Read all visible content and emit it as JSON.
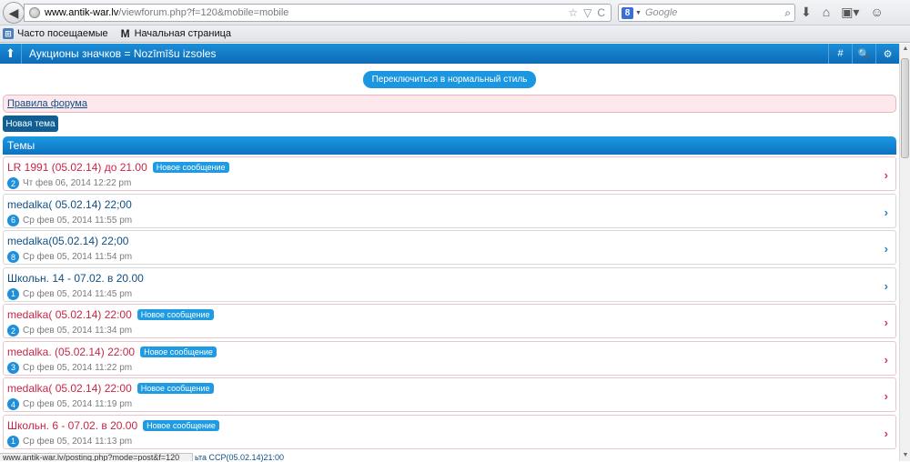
{
  "browser": {
    "url_host": "www.antik-war.lv",
    "url_path": "/viewforum.php?f=120&mobile=mobile",
    "search_engine_letter": "8",
    "search_placeholder": "Google",
    "bookmarks": [
      {
        "label": "Часто посещаемые",
        "icon": "frequent-icon"
      },
      {
        "label": "Начальная страница",
        "icon": "m-icon"
      }
    ],
    "status_url": "www.antik-war.lv/posting.php?mode=post&f=120"
  },
  "header": {
    "title": "Аукционы значков = Nozīmīšu izsoles",
    "buttons": [
      {
        "name": "hash-button",
        "glyph": "#"
      },
      {
        "name": "search-button",
        "glyph": "🔍"
      },
      {
        "name": "settings-button",
        "glyph": "⚙"
      }
    ]
  },
  "switch_style_label": "Переключиться в нормальный стиль",
  "rules_label": "Правила форума",
  "new_topic_label": "Новая тема",
  "topics_heading": "Темы",
  "badge_label": "Новое сообщение",
  "topics": [
    {
      "title": "LR 1991 (05.02.14) до 21.00",
      "count": "2",
      "date": "Чт фев 06, 2014 12:22 pm",
      "new": true
    },
    {
      "title": "medalka( 05.02.14) 22;00",
      "count": "6",
      "date": "Ср фев 05, 2014 11:55 pm",
      "new": false
    },
    {
      "title": "medalka(05.02.14) 22;00",
      "count": "8",
      "date": "Ср фев 05, 2014 11:54 pm",
      "new": false
    },
    {
      "title": "Школьн. 14 - 07.02. в 20.00",
      "count": "1",
      "date": "Ср фев 05, 2014 11:45 pm",
      "new": false
    },
    {
      "title": "medalka( 05.02.14) 22:00",
      "count": "2",
      "date": "Ср фев 05, 2014 11:34 pm",
      "new": true
    },
    {
      "title": "medalka. (05.02.14) 22:00",
      "count": "3",
      "date": "Ср фев 05, 2014 11:22 pm",
      "new": true
    },
    {
      "title": "medalka( 05.02.14) 22:00",
      "count": "4",
      "date": "Ср фев 05, 2014 11:19 pm",
      "new": true
    },
    {
      "title": "Школьн. 6 - 07.02. в 20.00",
      "count": "1",
      "date": "Ср фев 05, 2014 11:13 pm",
      "new": true
    }
  ],
  "peek_text": "ьта CCP(05.02.14)21:00"
}
